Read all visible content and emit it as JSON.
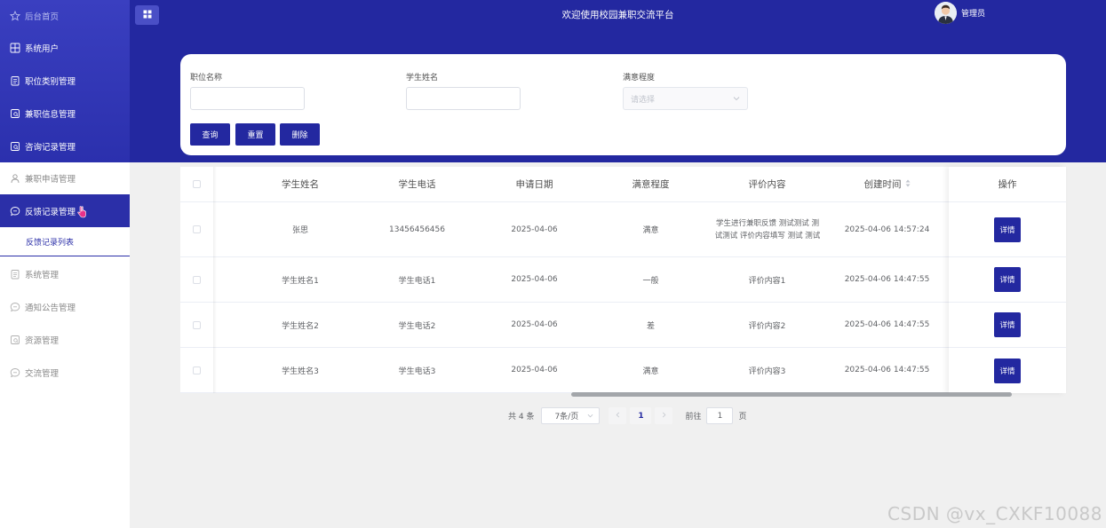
{
  "sidebar": {
    "top_items": [
      {
        "label": "后台首页",
        "icon": "star-icon"
      },
      {
        "label": "系统用户",
        "icon": "grid-icon"
      },
      {
        "label": "职位类别管理",
        "icon": "clipboard-icon"
      },
      {
        "label": "兼职信息管理",
        "icon": "search-doc-icon"
      },
      {
        "label": "咨询记录管理",
        "icon": "search-doc-icon"
      }
    ],
    "items": [
      {
        "label": "兼职申请管理",
        "icon": "user-icon"
      },
      {
        "label": "反馈记录管理",
        "icon": "chat-icon"
      },
      {
        "label": "反馈记录列表"
      },
      {
        "label": "系统管理",
        "icon": "clipboard-icon"
      },
      {
        "label": "通知公告管理",
        "icon": "chat-icon"
      },
      {
        "label": "资源管理",
        "icon": "search-doc-icon"
      },
      {
        "label": "交流管理",
        "icon": "chat-icon"
      }
    ]
  },
  "header": {
    "title": "欢迎使用校园兼职交流平台",
    "user_name": "管理员"
  },
  "search": {
    "fields": [
      {
        "label": "职位名称",
        "value": ""
      },
      {
        "label": "学生姓名",
        "value": ""
      },
      {
        "label": "满意程度",
        "placeholder": "请选择"
      }
    ],
    "buttons": [
      "查询",
      "重置",
      "删除"
    ]
  },
  "table": {
    "columns": [
      "学生姓名",
      "学生电话",
      "申请日期",
      "满意程度",
      "评价内容",
      "创建时间",
      "操作"
    ],
    "sort_icon": "sort-caret-icon",
    "detail_label": "详情",
    "rows": [
      {
        "name": "张思",
        "phone": "13456456456",
        "date": "2025-04-06",
        "satisfaction": "满意",
        "comment": "学生进行兼职反馈 测试测试 测试测试 评价内容填写 测试 测试",
        "created": "2025-04-06 14:57:24"
      },
      {
        "name": "学生姓名1",
        "phone": "学生电话1",
        "date": "2025-04-06",
        "satisfaction": "一般",
        "comment": "评价内容1",
        "created": "2025-04-06 14:47:55"
      },
      {
        "name": "学生姓名2",
        "phone": "学生电话2",
        "date": "2025-04-06",
        "satisfaction": "差",
        "comment": "评价内容2",
        "created": "2025-04-06 14:47:55"
      },
      {
        "name": "学生姓名3",
        "phone": "学生电话3",
        "date": "2025-04-06",
        "satisfaction": "满意",
        "comment": "评价内容3",
        "created": "2025-04-06 14:47:55"
      }
    ]
  },
  "pagination": {
    "total": "共 4 条",
    "page_size": "7条/页",
    "current_page": "1",
    "goto_label": "前往",
    "goto_value": "1",
    "page_suffix": "页"
  },
  "watermark": "CSDN @vx_CXKF10088",
  "colors": {
    "primary": "#2328a0",
    "sidebar_top": "#3a3fc0",
    "accent_cursor": "#e8318a"
  }
}
